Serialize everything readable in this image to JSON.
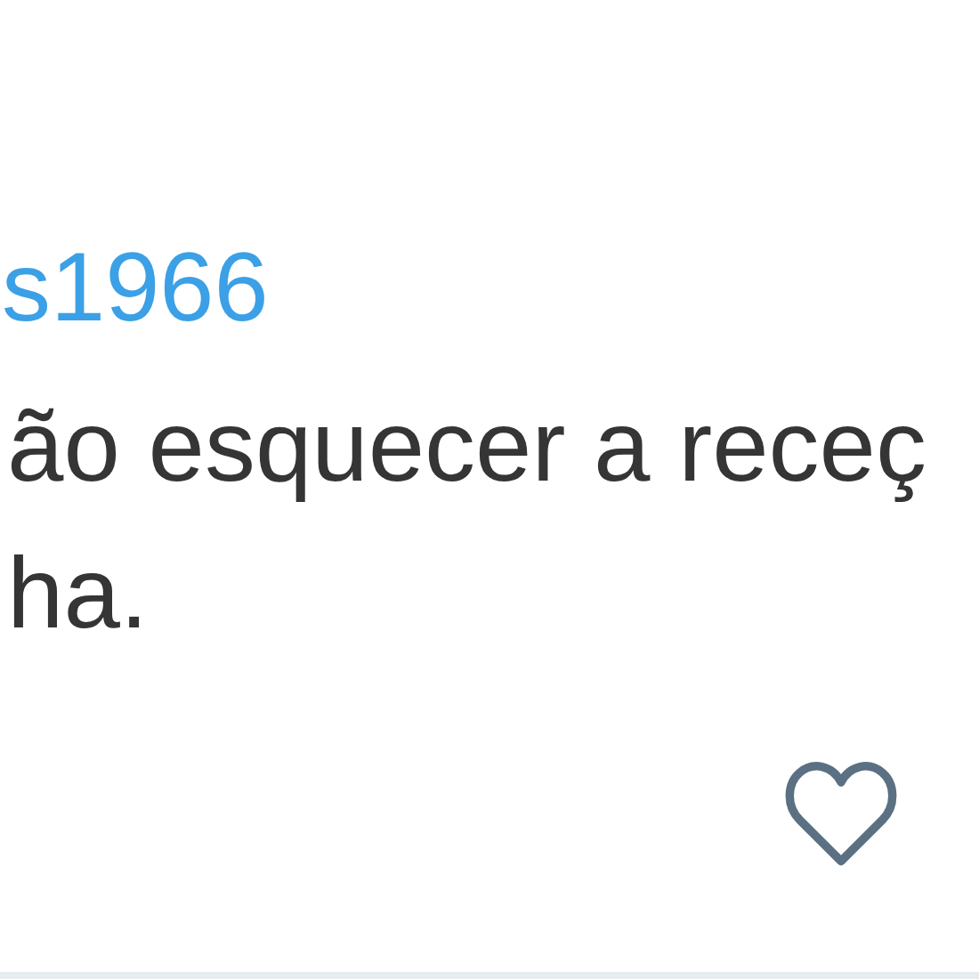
{
  "reply": {
    "username": "s1966",
    "text_lines": [
      "ão esquecer a receç",
      "ha."
    ]
  },
  "actions": [
    {
      "kind": "like",
      "liked": false
    }
  ]
}
